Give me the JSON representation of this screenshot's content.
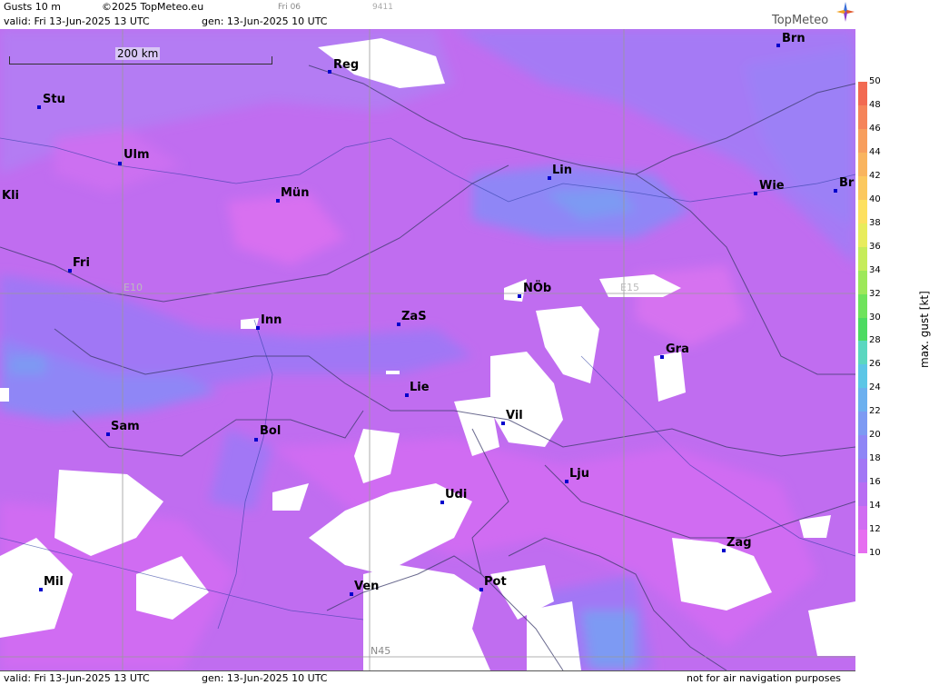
{
  "header": {
    "title": "Gusts 10 m",
    "copyright": "©2025 TopMeteo.eu",
    "run": "Fri 06",
    "code": "9411",
    "valid": "valid:  Fri  13-Jun-2025  13 UTC",
    "gen": "gen: 13-Jun-2025 10 UTC",
    "brand": "TopMeteo"
  },
  "footer": {
    "valid": "valid:  Fri  13-Jun-2025  13 UTC",
    "gen": "gen: 13-Jun-2025 10 UTC",
    "disclaimer": "not for air navigation purposes"
  },
  "scale": {
    "label": "200 km"
  },
  "grid": {
    "e10": "E10",
    "e15": "E15",
    "n45": "N45"
  },
  "cities": [
    {
      "id": "brn",
      "name": "Brn"
    },
    {
      "id": "reg",
      "name": "Reg"
    },
    {
      "id": "stu",
      "name": "Stu"
    },
    {
      "id": "ulm",
      "name": "Ulm"
    },
    {
      "id": "lin",
      "name": "Lin"
    },
    {
      "id": "wie",
      "name": "Wie"
    },
    {
      "id": "bra",
      "name": "Br"
    },
    {
      "id": "kli",
      "name": "Kli"
    },
    {
      "id": "mun",
      "name": "Mün"
    },
    {
      "id": "fri",
      "name": "Fri"
    },
    {
      "id": "nob",
      "name": "NÖb"
    },
    {
      "id": "inn",
      "name": "Inn"
    },
    {
      "id": "zas",
      "name": "ZaS"
    },
    {
      "id": "gra",
      "name": "Gra"
    },
    {
      "id": "lie",
      "name": "Lie"
    },
    {
      "id": "vil",
      "name": "Vil"
    },
    {
      "id": "sam",
      "name": "Sam"
    },
    {
      "id": "bol",
      "name": "Bol"
    },
    {
      "id": "lju",
      "name": "Lju"
    },
    {
      "id": "udi",
      "name": "Udi"
    },
    {
      "id": "zag",
      "name": "Zag"
    },
    {
      "id": "mil",
      "name": "Mil"
    },
    {
      "id": "ven",
      "name": "Ven"
    },
    {
      "id": "pot",
      "name": "Pot"
    }
  ],
  "legend": {
    "title": "max. gust  [kt]",
    "ticks": [
      "50",
      "48",
      "46",
      "44",
      "42",
      "40",
      "38",
      "36",
      "34",
      "32",
      "30",
      "28",
      "26",
      "24",
      "22",
      "20",
      "18",
      "16",
      "14",
      "12",
      "10"
    ],
    "colors": [
      "#f26a52",
      "#f5845a",
      "#f79e5e",
      "#f9b45f",
      "#fbc85f",
      "#fde05f",
      "#e8ec5c",
      "#c6ec5a",
      "#9de85a",
      "#6fe35c",
      "#4ddb62",
      "#5bd7c0",
      "#5cc6e6",
      "#6cb0ef",
      "#7d9af3",
      "#8f86f6",
      "#a277f5",
      "#b86ef3",
      "#d06cf2",
      "#e66ef0"
    ]
  }
}
